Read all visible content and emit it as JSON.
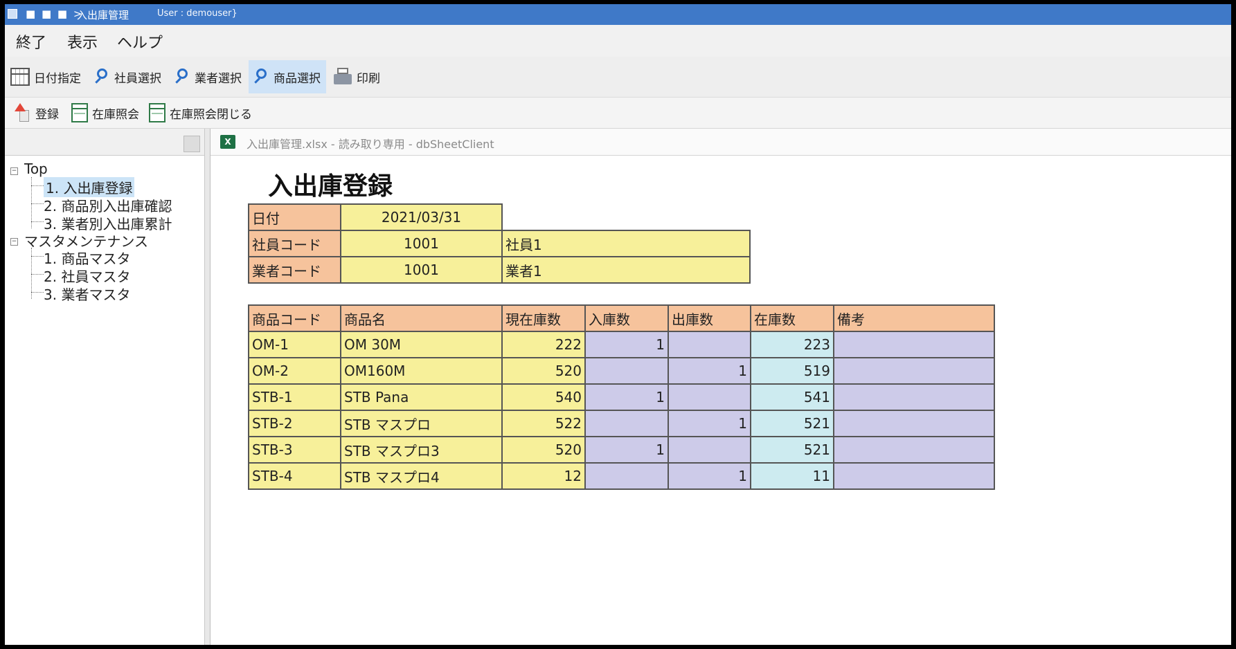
{
  "titlebar": {
    "qat": "■ ■ ■ >",
    "title": "入出庫管理",
    "user": "User : demouser}"
  },
  "menu": [
    "終了",
    "表示",
    "ヘルプ"
  ],
  "toolbar1": [
    "日付指定",
    "社員選択",
    "業者選択",
    "商品選択",
    "印刷"
  ],
  "toolbar2": [
    "登録",
    "在庫照会",
    "在庫照会閉じる"
  ],
  "tree": {
    "root": "Top",
    "group1": [
      "1. 入出庫登録",
      "2. 商品別入出庫確認",
      "3. 業者別入出庫累計"
    ],
    "root2": "マスタメンテナンス",
    "group2": [
      "1. 商品マスタ",
      "2. 社員マスタ",
      "3. 業者マスタ"
    ]
  },
  "doc": {
    "title": "入出庫管理.xlsx - 読み取り専用 - dbSheetClient",
    "app_icon": "X"
  },
  "sheet": {
    "title": "入出庫登録",
    "header_rows": [
      {
        "label": "日付",
        "value": "2021/03/31",
        "name": ""
      },
      {
        "label": "社員コード",
        "value": "1001",
        "name": "社員1"
      },
      {
        "label": "業者コード",
        "value": "1001",
        "name": "業者1"
      }
    ],
    "columns": [
      "商品コード",
      "商品名",
      "現在庫数",
      "入庫数",
      "出庫数",
      "在庫数",
      "備考"
    ],
    "rows": [
      [
        "OM-1",
        "OM 30M",
        "222",
        "1",
        "",
        "223",
        ""
      ],
      [
        "OM-2",
        "OM160M",
        "520",
        "",
        "1",
        "519",
        ""
      ],
      [
        "STB-1",
        "STB Pana",
        "540",
        "1",
        "",
        "541",
        ""
      ],
      [
        "STB-2",
        "STB マスプロ",
        "522",
        "",
        "1",
        "521",
        ""
      ],
      [
        "STB-3",
        "STB マスプロ3",
        "520",
        "1",
        "",
        "521",
        ""
      ],
      [
        "STB-4",
        "STB マスプロ4",
        "12",
        "",
        "1",
        "11",
        ""
      ]
    ]
  },
  "colors": {
    "header": "#f6c39c",
    "input": "#f7f09a",
    "entry": "#cdcbe9",
    "stock": "#cdebf0",
    "titlebar": "#3f79c8"
  }
}
